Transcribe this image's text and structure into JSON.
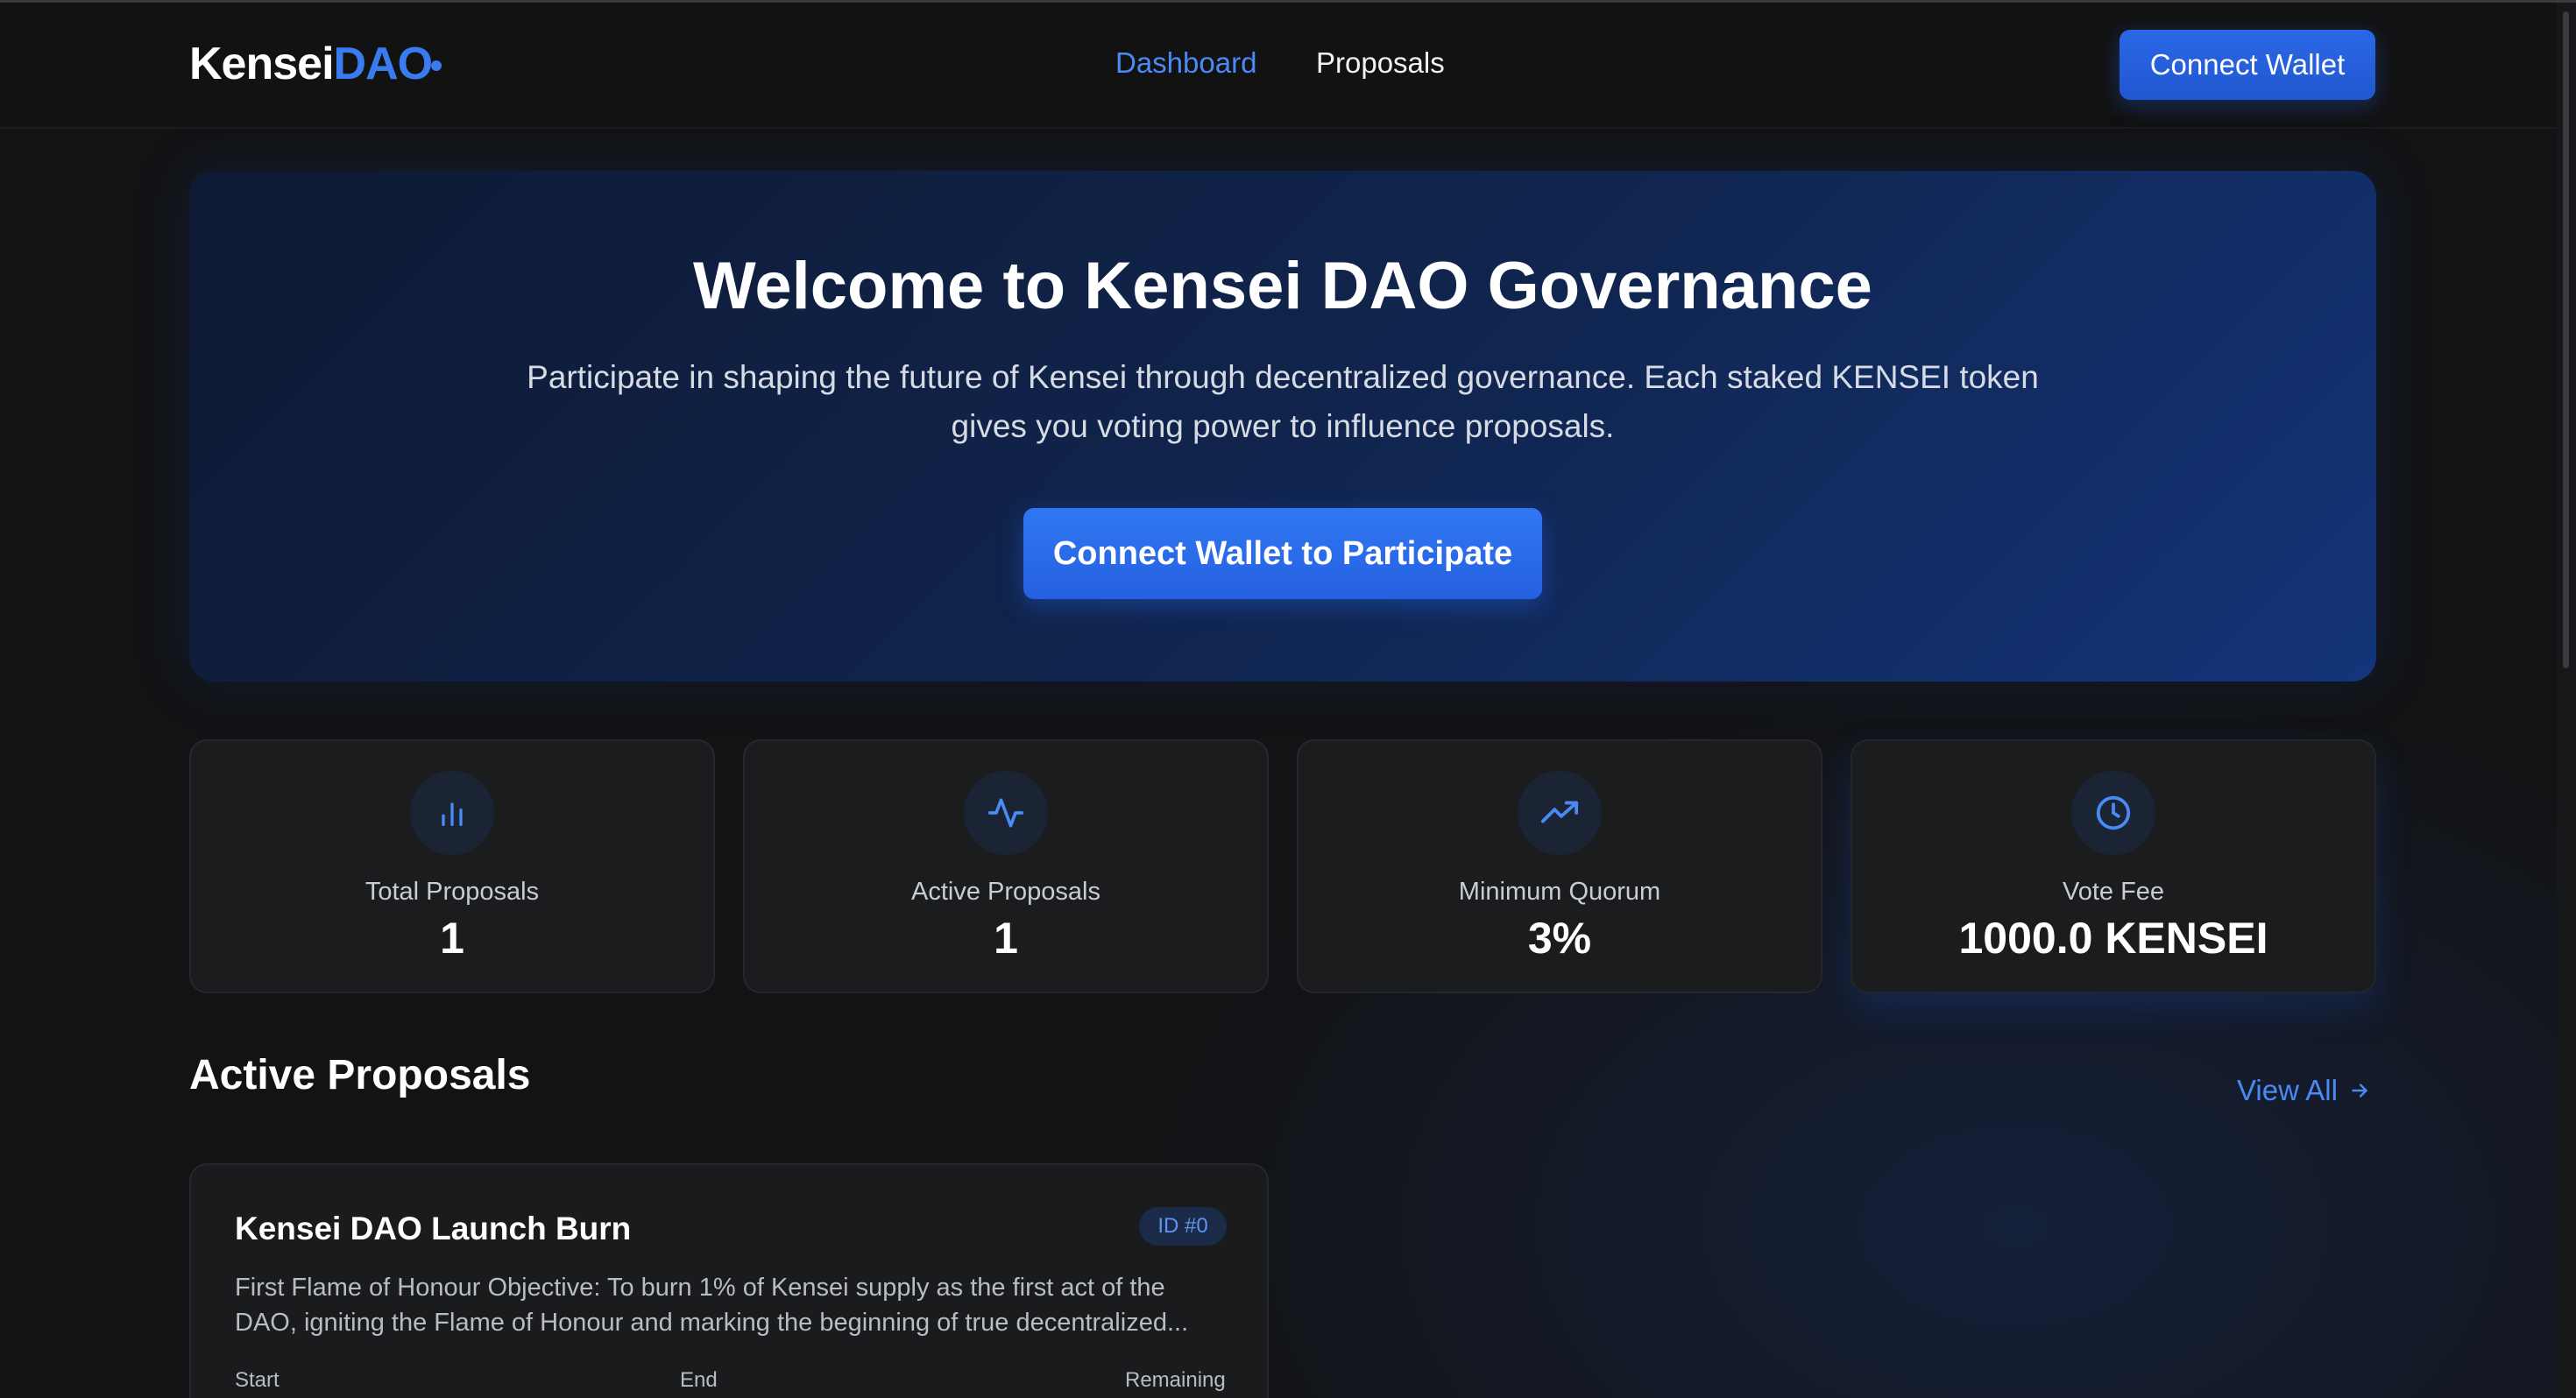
{
  "brand": {
    "name_part1": "Kensei",
    "name_part2": "DAO",
    "accent_color": "#3b7bf0"
  },
  "nav": {
    "links": [
      {
        "label": "Dashboard",
        "active": true
      },
      {
        "label": "Proposals",
        "active": false
      }
    ],
    "connect_label": "Connect Wallet"
  },
  "hero": {
    "title": "Welcome to Kensei DAO Governance",
    "subtitle": "Participate in shaping the future of Kensei through decentralized governance. Each staked KENSEI token gives you voting power to influence proposals.",
    "cta_label": "Connect Wallet to Participate"
  },
  "stats": [
    {
      "icon": "bar-chart-icon",
      "label": "Total Proposals",
      "value": "1"
    },
    {
      "icon": "activity-icon",
      "label": "Active Proposals",
      "value": "1"
    },
    {
      "icon": "trending-up-icon",
      "label": "Minimum Quorum",
      "value": "3%"
    },
    {
      "icon": "clock-icon",
      "label": "Vote Fee",
      "value": "1000.0 KENSEI"
    }
  ],
  "section": {
    "title": "Active Proposals",
    "view_all_label": "View All"
  },
  "proposals": [
    {
      "title": "Kensei DAO Launch Burn",
      "id_badge": "ID #0",
      "description": "First Flame of Honour Objective: To burn 1% of Kensei supply as the first act of the DAO, igniting the Flame of Honour and marking the beginning of true decentralized...",
      "meta_start_label": "Start",
      "meta_end_label": "End",
      "meta_remaining_label": "Remaining"
    }
  ]
}
